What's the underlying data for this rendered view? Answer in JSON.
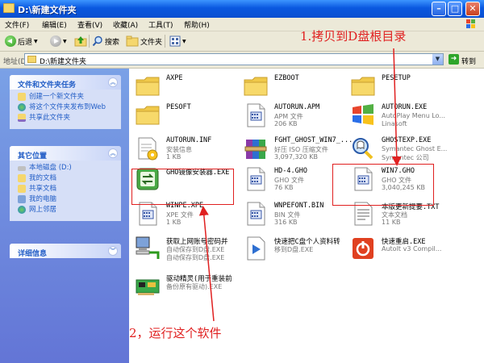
{
  "window": {
    "title": "D:\\新建文件夹"
  },
  "menu": [
    "文件(F)",
    "编辑(E)",
    "查看(V)",
    "收藏(A)",
    "工具(T)",
    "帮助(H)"
  ],
  "toolbar": {
    "back": "后退",
    "search": "搜索",
    "folders": "文件夹"
  },
  "address": {
    "label": "地址(D)",
    "value": "D:\\新建文件夹",
    "go": "转到"
  },
  "left_panels": [
    {
      "title": "文件和文件夹任务",
      "items": [
        "创建一个新文件夹",
        "将这个文件夹发布到Web",
        "共享此文件夹"
      ]
    },
    {
      "title": "其它位置",
      "items": [
        "本地磁盘 (D:)",
        "我的文档",
        "共享文档",
        "我的电脑",
        "网上邻居"
      ]
    },
    {
      "title": "详细信息",
      "items": []
    }
  ],
  "files": [
    {
      "name": "AXPE",
      "l1": "",
      "l2": "",
      "icon": "folder-icon",
      "col": 0,
      "row": 0
    },
    {
      "name": "EZBOOT",
      "l1": "",
      "l2": "",
      "icon": "folder-icon",
      "col": 1,
      "row": 0
    },
    {
      "name": "PESETUP",
      "l1": "",
      "l2": "",
      "icon": "folder-icon",
      "col": 2,
      "row": 0
    },
    {
      "name": "PESOFT",
      "l1": "",
      "l2": "",
      "icon": "folder-icon",
      "col": 0,
      "row": 1
    },
    {
      "name": "AUTORUN.APM",
      "l1": "APM 文件",
      "l2": "206 KB",
      "icon": "document-icon",
      "col": 1,
      "row": 1
    },
    {
      "name": "AUTORUN.EXE",
      "l1": "AutoPlay Menu Lo...",
      "l2": "Linasoft",
      "icon": "windows-logo-icon",
      "col": 2,
      "row": 1
    },
    {
      "name": "AUTORUN.INF",
      "l1": "安装信息",
      "l2": "1 KB",
      "icon": "setup-info-icon",
      "col": 0,
      "row": 2
    },
    {
      "name": "FGHT_GHOST_WIN7_...",
      "l1": "好压 ISO 压缩文件",
      "l2": "3,097,320 KB",
      "icon": "archive-icon",
      "col": 1,
      "row": 2
    },
    {
      "name": "GHOSTEXP.EXE",
      "l1": "Symantec Ghost E...",
      "l2": "Symantec 公司",
      "icon": "ghost-icon",
      "col": 2,
      "row": 2
    },
    {
      "name": "GHO镜像安装器.EXE",
      "l1": "",
      "l2": "",
      "icon": "installer-icon",
      "col": 0,
      "row": 3
    },
    {
      "name": "HD-4.GHO",
      "l1": "GHO 文件",
      "l2": "76 KB",
      "icon": "document-icon",
      "col": 1,
      "row": 3
    },
    {
      "name": "WIN7.GHO",
      "l1": "GHO 文件",
      "l2": "3,040,245 KB",
      "icon": "document-icon",
      "col": 2,
      "row": 3
    },
    {
      "name": "WINPE.XPE",
      "l1": "XPE 文件",
      "l2": "1 KB",
      "icon": "document-icon",
      "col": 0,
      "row": 4
    },
    {
      "name": "WNPEFONT.BIN",
      "l1": "BIN 文件",
      "l2": "316 KB",
      "icon": "document-icon",
      "col": 1,
      "row": 4
    },
    {
      "name": "本版更新提要.TXT",
      "l1": "文本文档",
      "l2": "11 KB",
      "icon": "text-file-icon",
      "col": 2,
      "row": 4
    },
    {
      "name": "获取上网账号密码并",
      "l1": "自动保存到D盘.EXE",
      "l2": "自动保存到D盘.EXE",
      "icon": "network-pc-icon",
      "col": 0,
      "row": 5
    },
    {
      "name": "快速把C盘个人资料转",
      "l1": "移到D盘.EXE",
      "l2": "",
      "icon": "media-arrow-icon",
      "col": 1,
      "row": 5
    },
    {
      "name": "快速重启.EXE",
      "l1": "AutoIt v3 Compil...",
      "l2": "",
      "icon": "power-icon",
      "col": 2,
      "row": 5
    },
    {
      "name": "驱动精灵(用于重装前",
      "l1": "备份原有驱动).EXE",
      "l2": "",
      "icon": "driver-card-icon",
      "col": 0,
      "row": 6
    }
  ],
  "annotations": {
    "copy_label": "1.拷贝到D盘根目录",
    "run_label": "2，运行这个软件"
  },
  "colors": {
    "accent": "#215dc6",
    "annotation": "#e02020",
    "title_bar": "#0a58e0"
  }
}
